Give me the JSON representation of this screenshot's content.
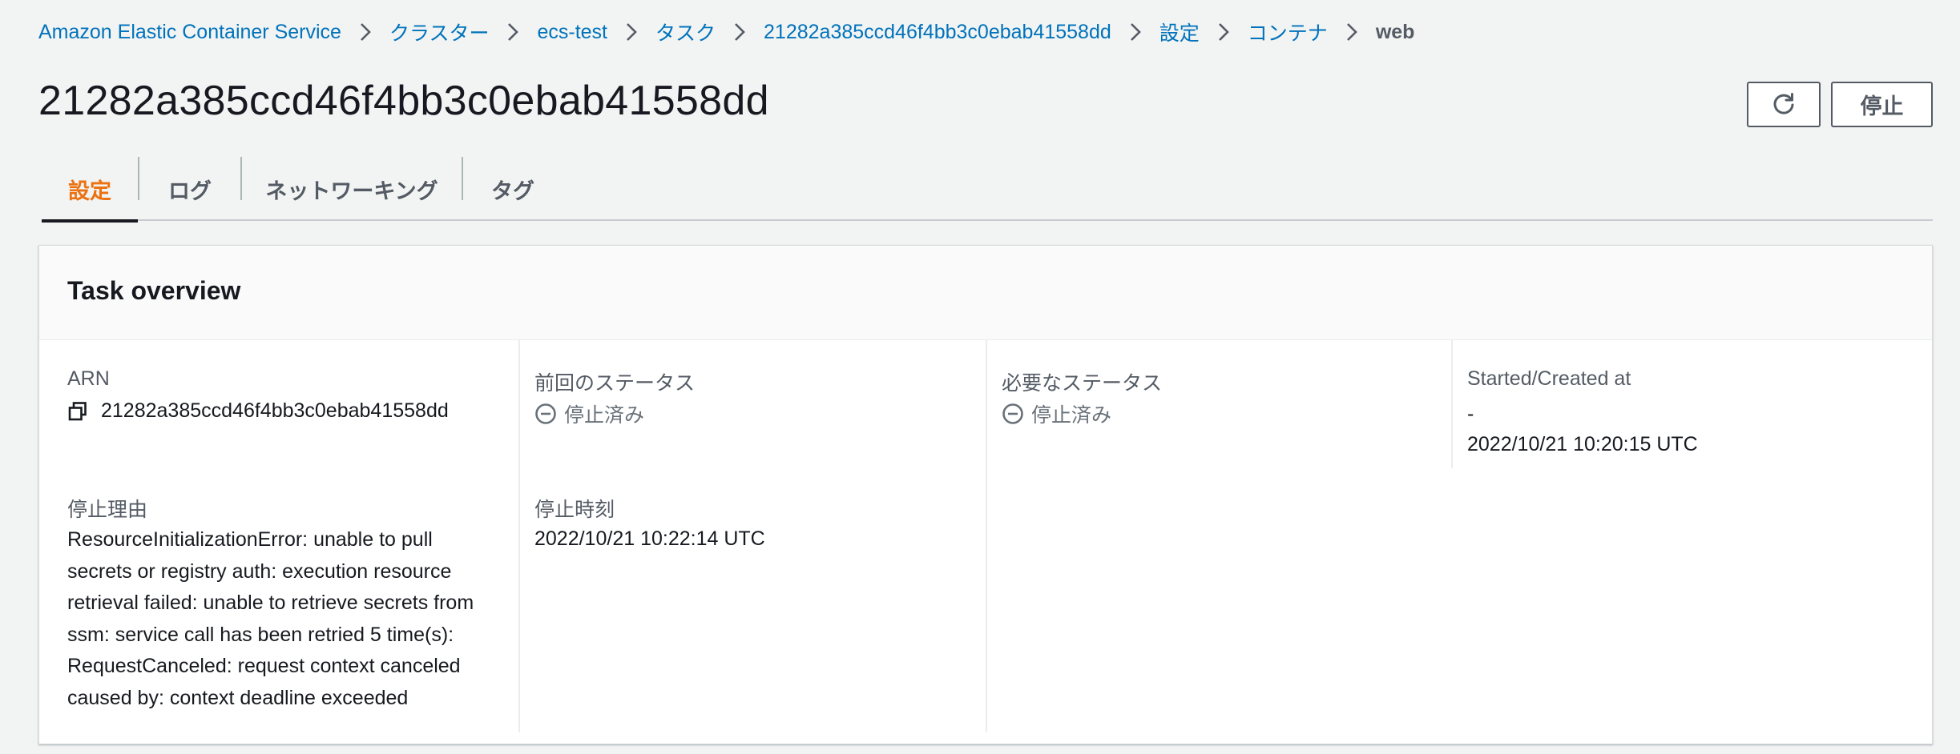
{
  "breadcrumb": [
    {
      "label": "Amazon Elastic Container Service"
    },
    {
      "label": "クラスター"
    },
    {
      "label": "ecs-test"
    },
    {
      "label": "タスク"
    },
    {
      "label": "21282a385ccd46f4bb3c0ebab41558dd"
    },
    {
      "label": "設定"
    },
    {
      "label": "コンテナ"
    },
    {
      "label": "web"
    }
  ],
  "page_title": "21282a385ccd46f4bb3c0ebab41558dd",
  "header_actions": {
    "refresh_icon": "refresh-icon",
    "stop_label": "停止"
  },
  "tabs": [
    {
      "label": "設定",
      "active": true
    },
    {
      "label": "ログ",
      "active": false
    },
    {
      "label": "ネットワーキング",
      "active": false
    },
    {
      "label": "タグ",
      "active": false
    }
  ],
  "panel": {
    "title": "Task overview",
    "fields": {
      "arn": {
        "label": "ARN",
        "value": "21282a385ccd46f4bb3c0ebab41558dd",
        "icon": "copy-icon"
      },
      "last_status": {
        "label": "前回のステータス",
        "value": "停止済み",
        "icon": "stopped-status-icon"
      },
      "desired_status": {
        "label": "必要なステータス",
        "value": "停止済み",
        "icon": "stopped-status-icon"
      },
      "started_created": {
        "label": "Started/Created at",
        "started": "-",
        "created": "2022/10/21 10:20:15 UTC"
      },
      "stopped_reason": {
        "label": "停止理由",
        "lines": [
          "ResourceInitializationError: unable to pull",
          "secrets or registry auth: execution resource",
          "retrieval failed: unable to retrieve secrets from",
          "ssm: service call has been retried 5 time(s):",
          "RequestCanceled: request context canceled",
          "caused by: context deadline exceeded"
        ]
      },
      "stopped_at": {
        "label": "停止時刻",
        "value": "2022/10/21 10:22:14 UTC"
      }
    }
  },
  "colors": {
    "link": "#0073bb",
    "active_tab": "#ec7211",
    "text": "#16191f",
    "muted": "#545b64",
    "background": "#f2f3f3"
  }
}
